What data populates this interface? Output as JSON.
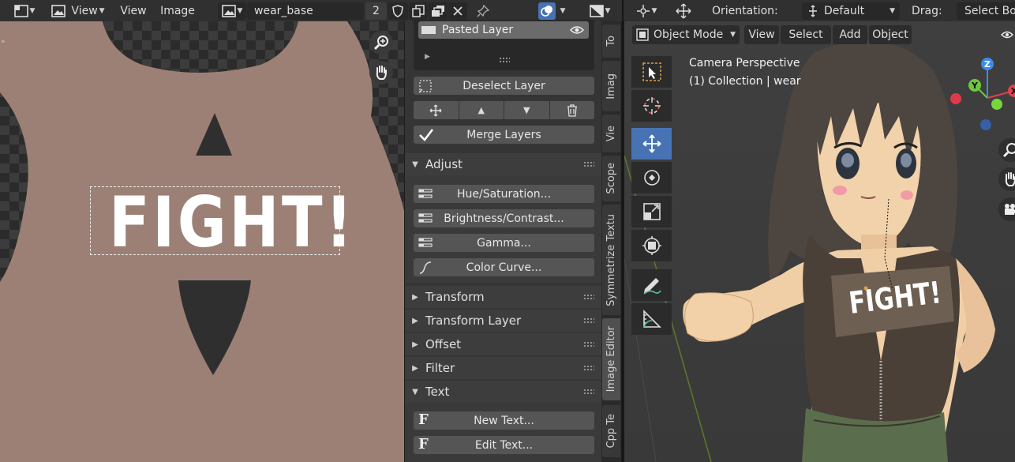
{
  "image_editor": {
    "header": {
      "view_menu_1": "View",
      "view_menu_2": "View",
      "image_menu": "Image",
      "image_name": "wear_base",
      "users_count": "2"
    },
    "texture_text": "FIGHT!"
  },
  "layers": {
    "pasted_layer": "Pasted Layer",
    "deselect_label": "Deselect Layer",
    "merge_label": "Merge Layers"
  },
  "sections": {
    "adjust": "Adjust",
    "transform": "Transform",
    "transform_layer": "Transform Layer",
    "offset": "Offset",
    "filter": "Filter",
    "text": "Text"
  },
  "adjust_buttons": {
    "hue": "Hue/Saturation...",
    "brightness": "Brightness/Contrast...",
    "gamma": "Gamma...",
    "curve": "Color Curve..."
  },
  "text_buttons": {
    "new": "New Text...",
    "edit": "Edit Text..."
  },
  "tabs": {
    "to": "To",
    "imag": "Imag",
    "vie": "Vie",
    "scope": "Scope",
    "symmetrize": "Symmetrize Textu",
    "image_editor": "Image Editor",
    "cpp": "Cpp Te"
  },
  "viewport": {
    "header": {
      "orientation_label": "Orientation:",
      "orientation_value": "Default",
      "drag_label": "Drag:",
      "drag_value": "Select Box"
    },
    "mode": "Object Mode",
    "menus": {
      "view": "View",
      "select": "Select",
      "add": "Add",
      "object": "Object"
    },
    "info_line1": "Camera Perspective",
    "info_line2": "(1) Collection | wear",
    "shirt_text": "FIGHT!",
    "axes": {
      "z": "Z",
      "y": "Y",
      "x": "X"
    }
  },
  "colors": {
    "skin": "#9c8075",
    "selection_blue": "#4772b3",
    "panel": "#353535",
    "header": "#303030"
  }
}
